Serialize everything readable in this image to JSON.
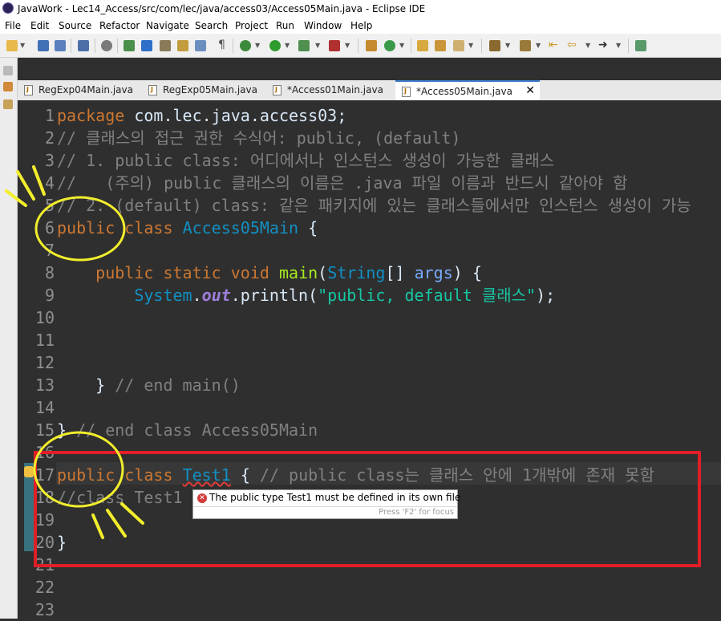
{
  "window": {
    "title": "JavaWork - Lec14_Access/src/com/lec/java/access03/Access05Main.java - Eclipse IDE"
  },
  "menu": [
    "File",
    "Edit",
    "Source",
    "Refactor",
    "Navigate",
    "Search",
    "Project",
    "Run",
    "Window",
    "Help"
  ],
  "tabs": [
    {
      "label": "RegExp04Main.java",
      "active": false
    },
    {
      "label": "RegExp05Main.java",
      "active": false
    },
    {
      "label": "*Access01Main.java",
      "active": false
    },
    {
      "label": "*Access05Main.java",
      "active": true,
      "close": "✕"
    }
  ],
  "editor": {
    "lines": [
      {
        "n": "1",
        "parts": [
          [
            "kw",
            "package"
          ],
          [
            "pl",
            " com.lec.java.access03;"
          ]
        ]
      },
      {
        "n": "2",
        "parts": [
          [
            "cm",
            "// 클래스의 접근 권한 수식어: public, (default)"
          ]
        ]
      },
      {
        "n": "3",
        "parts": [
          [
            "cm",
            "// 1. public class: 어디에서나 인스턴스 생성이 가능한 클래스"
          ]
        ]
      },
      {
        "n": "4",
        "parts": [
          [
            "cm",
            "//   (주의) public 클래스의 이름은 .java 파일 이름과 반드시 같아야 함"
          ]
        ]
      },
      {
        "n": "5",
        "parts": [
          [
            "cm",
            "// 2. (default) class: 같은 패키지에 있는 클래스들에서만 인스턴스 생성이 가능"
          ]
        ]
      },
      {
        "n": "6",
        "parts": [
          [
            "kw",
            "public"
          ],
          [
            "pl",
            " "
          ],
          [
            "kw",
            "class"
          ],
          [
            "pl",
            " "
          ],
          [
            "cls",
            "Access05Main"
          ],
          [
            "pl",
            " {"
          ]
        ]
      },
      {
        "n": "7",
        "parts": []
      },
      {
        "n": "8",
        "parts": [
          [
            "pl",
            "    "
          ],
          [
            "kw",
            "public"
          ],
          [
            "pl",
            " "
          ],
          [
            "kw",
            "static"
          ],
          [
            "pl",
            " "
          ],
          [
            "kw",
            "void"
          ],
          [
            "pl",
            " "
          ],
          [
            "meth",
            "main"
          ],
          [
            "pl",
            "("
          ],
          [
            "cls",
            "String"
          ],
          [
            "pl",
            "[] "
          ],
          [
            "param",
            "args"
          ],
          [
            "pl",
            ") {"
          ]
        ]
      },
      {
        "n": "9",
        "parts": [
          [
            "pl",
            "        "
          ],
          [
            "sysclr",
            "System"
          ],
          [
            "pl",
            "."
          ],
          [
            "fld",
            "out"
          ],
          [
            "pl",
            ".println("
          ],
          [
            "str",
            "\"public, default 클래스\""
          ],
          [
            "pl",
            ");"
          ]
        ]
      },
      {
        "n": "10",
        "parts": []
      },
      {
        "n": "11",
        "parts": []
      },
      {
        "n": "12",
        "parts": []
      },
      {
        "n": "13",
        "parts": [
          [
            "pl",
            "    } "
          ],
          [
            "cm",
            "// end main()"
          ]
        ]
      },
      {
        "n": "14",
        "parts": []
      },
      {
        "n": "15",
        "parts": [
          [
            "pl",
            "} "
          ],
          [
            "cm",
            "// end class Access05Main"
          ]
        ]
      },
      {
        "n": "16",
        "parts": []
      },
      {
        "n": "17",
        "parts": [
          [
            "kw",
            "public"
          ],
          [
            "pl",
            " "
          ],
          [
            "kw",
            "class"
          ],
          [
            "pl",
            " "
          ],
          [
            "err",
            "Test1"
          ],
          [
            "pl",
            " { "
          ],
          [
            "cm",
            "// public class는 클래스 안에 1개밖에 존재 못함"
          ]
        ]
      },
      {
        "n": "18",
        "parts": [
          [
            "cm",
            "//class Test1"
          ]
        ]
      },
      {
        "n": "19",
        "parts": []
      },
      {
        "n": "20",
        "parts": [
          [
            "pl",
            "}"
          ]
        ]
      },
      {
        "n": "21",
        "parts": []
      },
      {
        "n": "22",
        "parts": []
      },
      {
        "n": "23",
        "parts": []
      }
    ]
  },
  "tooltip": {
    "message": "The public type Test1 must be defined in its own file",
    "hint": "Press 'F2' for focus"
  },
  "colors": {
    "highlight_circle": "#f2ee2c",
    "highlight_box": "#e01f26",
    "editor_bg": "#2f2f2f"
  }
}
